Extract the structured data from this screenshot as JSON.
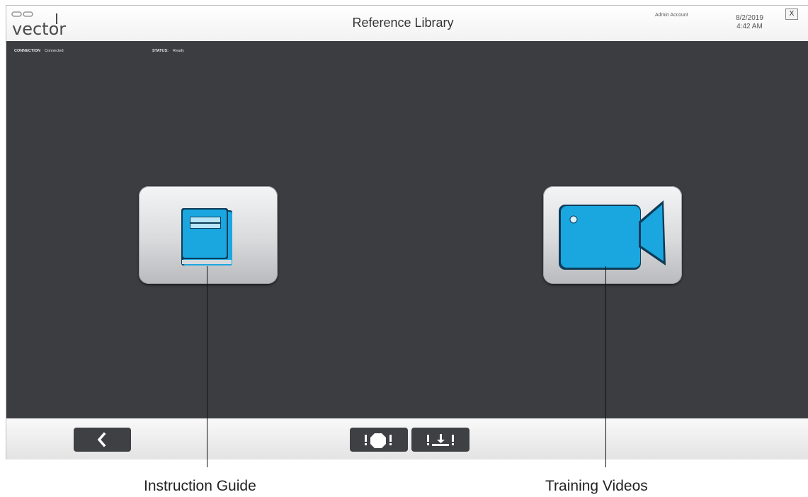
{
  "header": {
    "logo_text": "vector",
    "title": "Reference Library",
    "account": "Admin Account",
    "date": "8/2/2019",
    "time": "4:42 AM",
    "close_label": "X"
  },
  "status_bar": {
    "connection_label": "CONNECTION",
    "connection_value": "Connected",
    "status_label": "STATUS:",
    "status_value": "Ready"
  },
  "tiles": [
    {
      "name": "Instruction Guide",
      "icon": "book-icon"
    },
    {
      "name": "Training Videos",
      "icon": "video-camera-icon"
    }
  ],
  "footer": {
    "buttons": [
      {
        "name": "back",
        "icon": "chevron-left-icon"
      },
      {
        "name": "stop",
        "icon": "stop-alert-icon"
      },
      {
        "name": "download",
        "icon": "download-alert-icon"
      }
    ]
  },
  "callouts": {
    "instruction": "Instruction Guide",
    "training": "Training Videos"
  },
  "colors": {
    "accent": "#1aa7e0",
    "background": "#3b3d40",
    "button_dark": "#3e4044"
  }
}
